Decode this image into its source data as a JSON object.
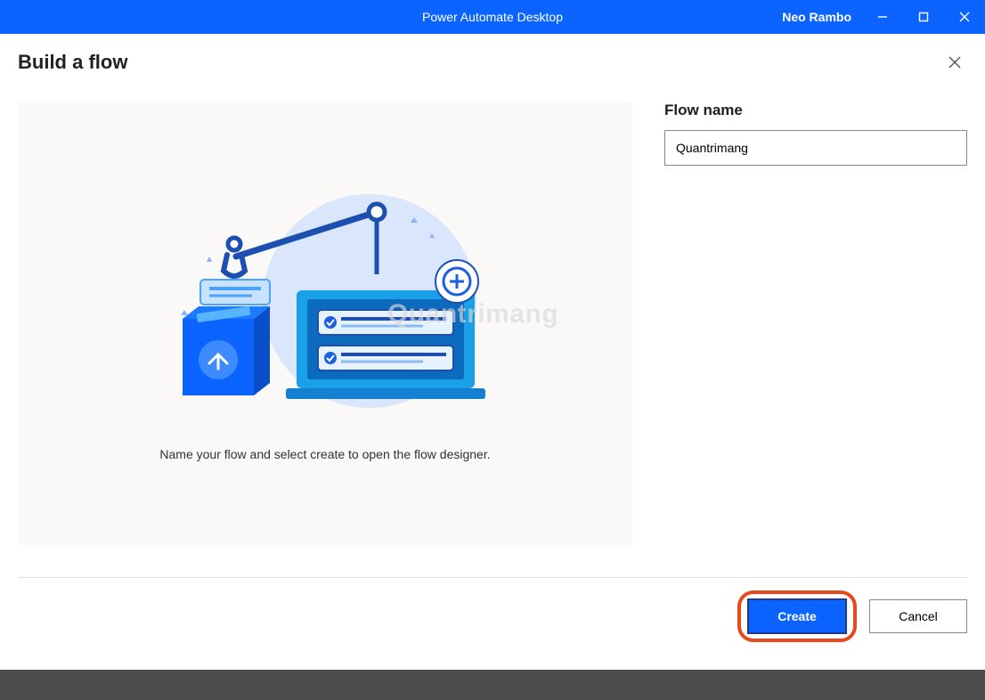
{
  "titlebar": {
    "app_title": "Power Automate Desktop",
    "user_name": "Neo Rambo"
  },
  "dialog": {
    "title": "Build a flow",
    "illustration_caption": "Name your flow and select create to open the flow designer.",
    "watermark": "Quantrimang"
  },
  "form": {
    "flow_name_label": "Flow name",
    "flow_name_value": "Quantrimang"
  },
  "footer": {
    "create_label": "Create",
    "cancel_label": "Cancel"
  }
}
